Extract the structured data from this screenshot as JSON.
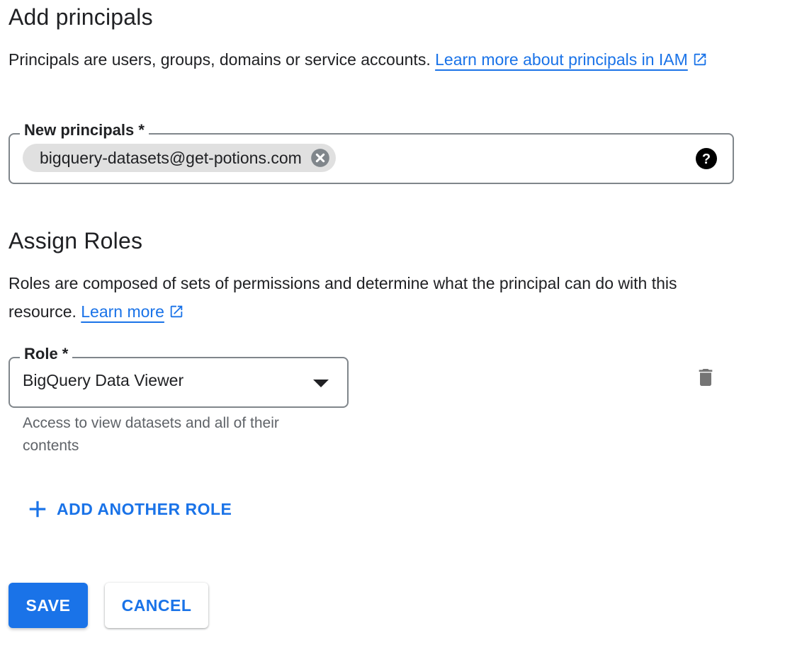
{
  "add_principals": {
    "title": "Add principals",
    "description": "Principals are users, groups, domains or service accounts.",
    "learn_more_link": "Learn more about principals in IAM",
    "field_label": "New principals *",
    "chips": [
      "bigquery-datasets@get-potions.com"
    ]
  },
  "assign_roles": {
    "title": "Assign Roles",
    "description": "Roles are composed of sets of permissions and determine what the principal can do with this resource.",
    "learn_more_link": "Learn more",
    "role_label": "Role *",
    "role_value": "BigQuery Data Viewer",
    "role_hint": "Access to view datasets and all of their contents",
    "add_another_role": "ADD ANOTHER ROLE"
  },
  "actions": {
    "save_label": "SAVE",
    "cancel_label": "CANCEL"
  },
  "icons": {
    "external_link": "external-link-icon",
    "chip_remove": "cancel-icon",
    "help": "help-icon",
    "dropdown": "arrow-drop-down-icon",
    "delete": "trash-icon",
    "add": "plus-icon"
  },
  "colors": {
    "accent": "#1a73e8",
    "text": "#202124",
    "secondary_text": "#5f6368",
    "chip_bg": "#e0e0e0",
    "field_border": "#80868b"
  }
}
